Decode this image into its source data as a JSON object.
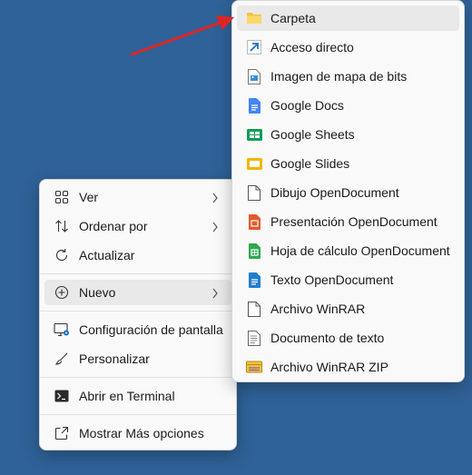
{
  "main_menu": {
    "items": [
      {
        "label": "Ver",
        "icon": "grid-view-icon",
        "submenu": true
      },
      {
        "label": "Ordenar por",
        "icon": "sort-icon",
        "submenu": true
      },
      {
        "label": "Actualizar",
        "icon": "refresh-icon",
        "submenu": false
      },
      {
        "label": "Nuevo",
        "icon": "new-plus-icon",
        "submenu": true
      },
      {
        "label": "Configuración de pantalla",
        "icon": "display-settings-icon",
        "submenu": false
      },
      {
        "label": "Personalizar",
        "icon": "brush-icon",
        "submenu": false
      },
      {
        "label": "Abrir en Terminal",
        "icon": "terminal-icon",
        "submenu": false
      },
      {
        "label": "Mostrar Más opciones",
        "icon": "more-options-icon",
        "submenu": false
      }
    ]
  },
  "new_submenu": {
    "items": [
      {
        "label": "Carpeta",
        "icon": "folder-icon"
      },
      {
        "label": "Acceso directo",
        "icon": "shortcut-icon"
      },
      {
        "label": "Imagen de mapa de bits",
        "icon": "bitmap-image-icon"
      },
      {
        "label": "Google Docs",
        "icon": "google-docs-icon"
      },
      {
        "label": "Google Sheets",
        "icon": "google-sheets-icon"
      },
      {
        "label": "Google Slides",
        "icon": "google-slides-icon"
      },
      {
        "label": "Dibujo OpenDocument",
        "icon": "document-icon"
      },
      {
        "label": "Presentación OpenDocument",
        "icon": "presentation-icon"
      },
      {
        "label": "Hoja de cálculo OpenDocument",
        "icon": "spreadsheet-icon"
      },
      {
        "label": "Texto OpenDocument",
        "icon": "text-document-icon"
      },
      {
        "label": "Archivo WinRAR",
        "icon": "document-icon"
      },
      {
        "label": "Documento de texto",
        "icon": "text-file-icon"
      },
      {
        "label": "Archivo WinRAR ZIP",
        "icon": "zip-archive-icon"
      }
    ]
  },
  "colors": {
    "desktop_background": "#2f6298",
    "menu_background": "#f9f9f9",
    "highlight": "#e9e9e9",
    "annotation_arrow": "#e02424"
  }
}
